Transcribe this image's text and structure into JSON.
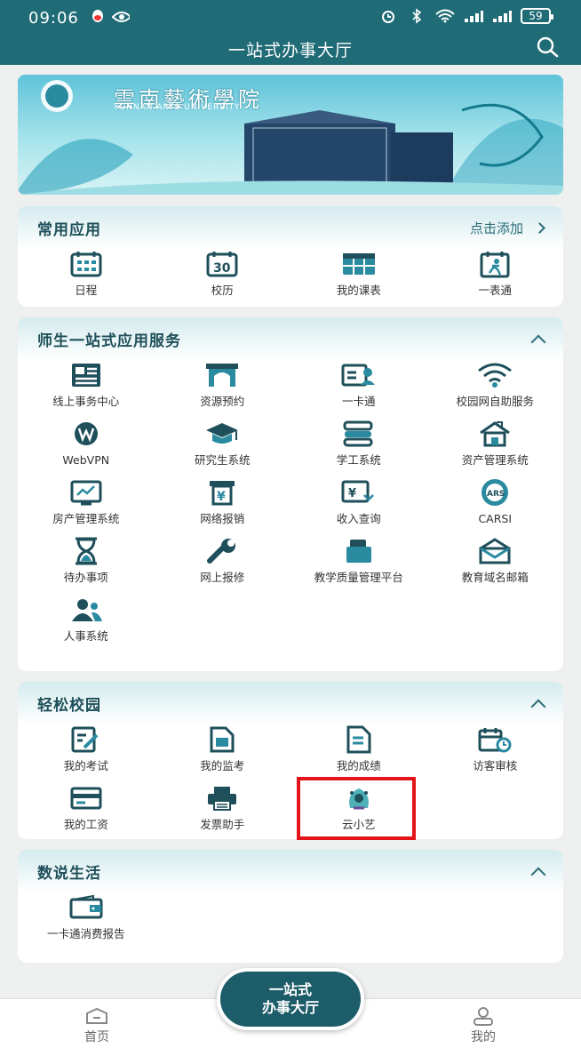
{
  "status": {
    "time": "09:06",
    "battery": "59"
  },
  "header": {
    "title": "一站式办事大厅"
  },
  "banner": {
    "university_cn": "雲南藝術學院",
    "university_en": "YUNNAN ARTS UNIVERSITY"
  },
  "common": {
    "title": "常用应用",
    "add_label": "点击添加",
    "items": [
      {
        "label": "日程",
        "icon": "calendar-grid-icon"
      },
      {
        "label": "校历",
        "icon": "calendar-30-icon"
      },
      {
        "label": "我的课表",
        "icon": "timetable-icon"
      },
      {
        "label": "一表通",
        "icon": "runner-form-icon"
      }
    ]
  },
  "services": {
    "title": "师生一站式应用服务",
    "items": [
      {
        "label": "线上事务中心",
        "icon": "affairs-icon"
      },
      {
        "label": "资源预约",
        "icon": "gate-icon"
      },
      {
        "label": "一卡通",
        "icon": "card-icon"
      },
      {
        "label": "校园网自助服务",
        "icon": "wifi-icon"
      },
      {
        "label": "WebVPN",
        "icon": "vpn-icon"
      },
      {
        "label": "研究生系统",
        "icon": "graduate-cap-icon"
      },
      {
        "label": "学工系统",
        "icon": "books-icon"
      },
      {
        "label": "资产管理系统",
        "icon": "house-icon"
      },
      {
        "label": "房产管理系统",
        "icon": "chart-screen-icon"
      },
      {
        "label": "网络报销",
        "icon": "yen-receipt-icon"
      },
      {
        "label": "收入查询",
        "icon": "income-icon"
      },
      {
        "label": "CARSI",
        "icon": "carsi-icon"
      },
      {
        "label": "待办事项",
        "icon": "hourglass-icon"
      },
      {
        "label": "网上报修",
        "icon": "wrench-icon"
      },
      {
        "label": "教学质量管理平台",
        "icon": "quality-icon"
      },
      {
        "label": "教育域名邮箱",
        "icon": "mail-icon"
      },
      {
        "label": "人事系统",
        "icon": "people-icon"
      }
    ]
  },
  "campus": {
    "title": "轻松校园",
    "items": [
      {
        "label": "我的考试",
        "icon": "exam-edit-icon"
      },
      {
        "label": "我的监考",
        "icon": "invigilate-icon"
      },
      {
        "label": "我的成绩",
        "icon": "grade-icon"
      },
      {
        "label": "访客审核",
        "icon": "visitor-icon"
      },
      {
        "label": "我的工资",
        "icon": "salary-card-icon"
      },
      {
        "label": "发票助手",
        "icon": "printer-icon"
      },
      {
        "label": "云小艺",
        "icon": "peacock-icon"
      }
    ]
  },
  "life": {
    "title": "数说生活",
    "items": [
      {
        "label": "一卡通消费报告",
        "icon": "wallet-icon"
      }
    ]
  },
  "tabbar": {
    "home": "首页",
    "center_line1": "一站式",
    "center_line2": "办事大厅",
    "mine": "我的"
  },
  "colors": {
    "header": "#1f6b76",
    "accent": "#2a6d79",
    "highlight": "#e3141a"
  }
}
